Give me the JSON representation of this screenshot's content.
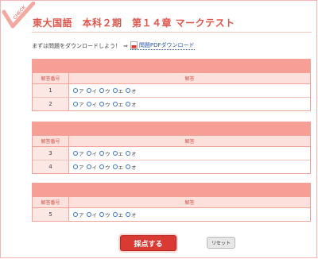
{
  "header": {
    "title": "東大国語　本科２期　第１４章 マークテスト",
    "stamp_label": "CHECK"
  },
  "intro": {
    "text": "まずは問題をダウンロードしよう！",
    "arrow": "⇒",
    "pdf_link_label": "問題PDFダウンロード"
  },
  "columns": {
    "number": "解答番号",
    "answer": "解答"
  },
  "options": [
    "ア",
    "イ",
    "ウ",
    "エ",
    "オ"
  ],
  "blocks": [
    {
      "rows": [
        {
          "number": "1"
        },
        {
          "number": "2"
        }
      ]
    },
    {
      "rows": [
        {
          "number": "3"
        },
        {
          "number": "4"
        }
      ]
    },
    {
      "rows": [
        {
          "number": "5"
        }
      ]
    }
  ],
  "actions": {
    "submit_label": "採点する",
    "reset_label": "リセット"
  },
  "colors": {
    "accent": "#e0554b",
    "header_band": "#f79e96",
    "submit": "#d93b34"
  }
}
